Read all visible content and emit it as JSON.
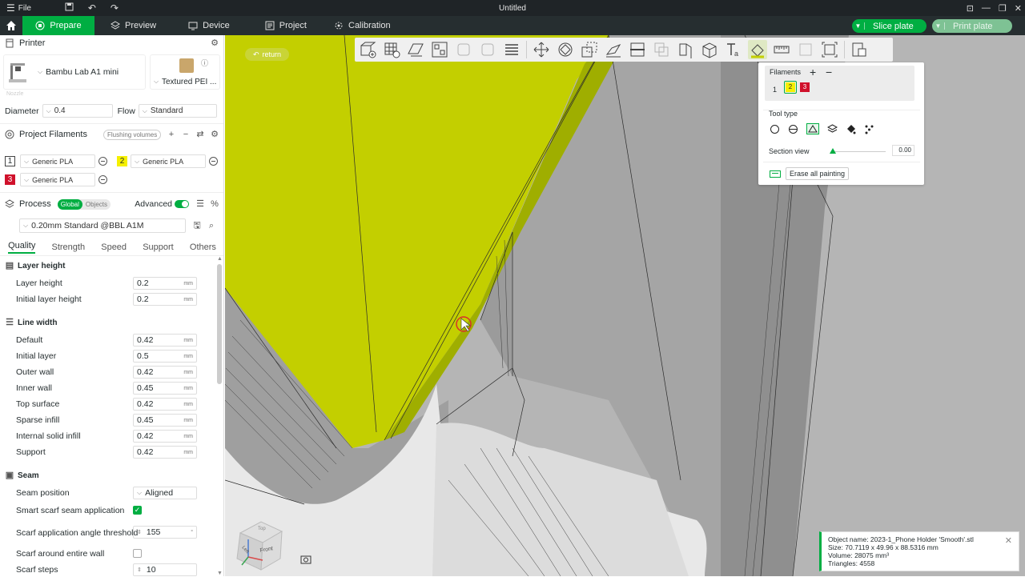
{
  "titlebar": {
    "menu_label": "File",
    "title": "Untitled"
  },
  "tabs": [
    {
      "label": "Prepare"
    },
    {
      "label": "Preview"
    },
    {
      "label": "Device"
    },
    {
      "label": "Project"
    },
    {
      "label": "Calibration"
    }
  ],
  "actions": {
    "slice_label": "Slice plate",
    "print_label": "Print plate"
  },
  "printer": {
    "section_label": "Printer",
    "name": "Bambu Lab A1 mini",
    "plate": "Textured PEI ...",
    "nozzle_caption": "Nozzle",
    "diameter_label": "Diameter",
    "diameter_value": "0.4",
    "flow_label": "Flow",
    "flow_value": "Standard"
  },
  "filaments": {
    "section_label": "Project Filaments",
    "flushing_label": "Flushing volumes",
    "items": [
      {
        "num": "1",
        "name": "Generic PLA",
        "color": "#ffffff"
      },
      {
        "num": "2",
        "name": "Generic PLA",
        "color": "#f5f000"
      },
      {
        "num": "3",
        "name": "Generic PLA",
        "color": "#d0112b"
      }
    ]
  },
  "process": {
    "section_label": "Process",
    "global_label": "Global",
    "objects_label": "Objects",
    "advanced_label": "Advanced",
    "preset": "0.20mm Standard @BBL A1M",
    "tabs": [
      "Quality",
      "Strength",
      "Speed",
      "Support",
      "Others"
    ]
  },
  "quality": {
    "layer_height_group": "Layer height",
    "layer_height": {
      "label": "Layer height",
      "value": "0.2",
      "unit": "mm"
    },
    "initial_layer_height": {
      "label": "Initial layer height",
      "value": "0.2",
      "unit": "mm"
    },
    "line_width_group": "Line width",
    "line_widths": [
      {
        "label": "Default",
        "value": "0.42",
        "unit": "mm"
      },
      {
        "label": "Initial layer",
        "value": "0.5",
        "unit": "mm"
      },
      {
        "label": "Outer wall",
        "value": "0.42",
        "unit": "mm"
      },
      {
        "label": "Inner wall",
        "value": "0.45",
        "unit": "mm"
      },
      {
        "label": "Top surface",
        "value": "0.42",
        "unit": "mm"
      },
      {
        "label": "Sparse infill",
        "value": "0.45",
        "unit": "mm"
      },
      {
        "label": "Internal solid infill",
        "value": "0.42",
        "unit": "mm"
      },
      {
        "label": "Support",
        "value": "0.42",
        "unit": "mm"
      }
    ],
    "seam_group": "Seam",
    "seam_position": {
      "label": "Seam position",
      "value": "Aligned"
    },
    "smart_scarf": {
      "label": "Smart scarf seam application",
      "checked": true
    },
    "scarf_angle": {
      "label": "Scarf application angle threshold",
      "value": "155",
      "unit": "°"
    },
    "scarf_entire": {
      "label": "Scarf around entire wall",
      "checked": false
    },
    "scarf_steps": {
      "label": "Scarf steps",
      "value": "10"
    }
  },
  "viewport": {
    "return_label": "return",
    "paint_panel": {
      "filaments_label": "Filaments",
      "filament_numbers": [
        "1",
        "2",
        "3"
      ],
      "tool_type_label": "Tool type",
      "section_view_label": "Section view",
      "section_view_value": "0.00",
      "section_view_fraction": 0,
      "erase_label": "Erase all painting"
    },
    "object_info": {
      "name": "Object name: 2023-1_Phone Holder 'Smooth'.stl",
      "size": "Size: 70.7119 x 49.96 x 88.5316 mm",
      "volume": "Volume: 28075 mm³",
      "triangles": "Triangles: 4558"
    },
    "cube_labels": {
      "top": "Top",
      "left": "Left",
      "front": "Front"
    }
  },
  "colors": {
    "accent": "#00ae42",
    "paint": "#c3cf00",
    "model": "#a9a9a9"
  }
}
